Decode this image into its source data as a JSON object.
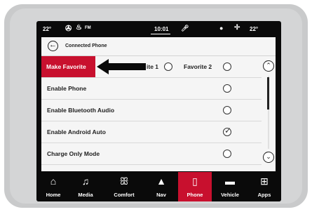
{
  "status": {
    "temp_left": "22°",
    "radio": "FM",
    "time": "10:01",
    "temp_right": "22°"
  },
  "header": {
    "title": "Connected Phone"
  },
  "favorite_row": {
    "label": "Make Favorite",
    "option1": "ite 1",
    "option2": "Favorite 2"
  },
  "rows": [
    {
      "label": "Enable Phone",
      "checked": false
    },
    {
      "label": "Enable Bluetooth Audio",
      "checked": false
    },
    {
      "label": "Enable Android Auto",
      "checked": true
    },
    {
      "label": "Charge Only Mode",
      "checked": false
    }
  ],
  "nav": [
    {
      "label": "Home",
      "icon": "home-icon",
      "glyph": "⌂",
      "active": false
    },
    {
      "label": "Media",
      "icon": "music-note-icon",
      "glyph": "♫",
      "active": false
    },
    {
      "label": "Comfort",
      "icon": "seat-icon",
      "glyph": "ꕥ",
      "active": false
    },
    {
      "label": "Nav",
      "icon": "navigation-arrow-icon",
      "glyph": "▲",
      "active": false
    },
    {
      "label": "Phone",
      "icon": "phone-icon",
      "glyph": "▯",
      "active": true
    },
    {
      "label": "Vehicle",
      "icon": "car-icon",
      "glyph": "▬",
      "active": false
    },
    {
      "label": "Apps",
      "icon": "apps-grid-icon",
      "glyph": "⊞",
      "active": false
    }
  ],
  "colors": {
    "accent": "#c8102e",
    "background": "#0a0a0a",
    "panel": "#f5f5f5"
  }
}
